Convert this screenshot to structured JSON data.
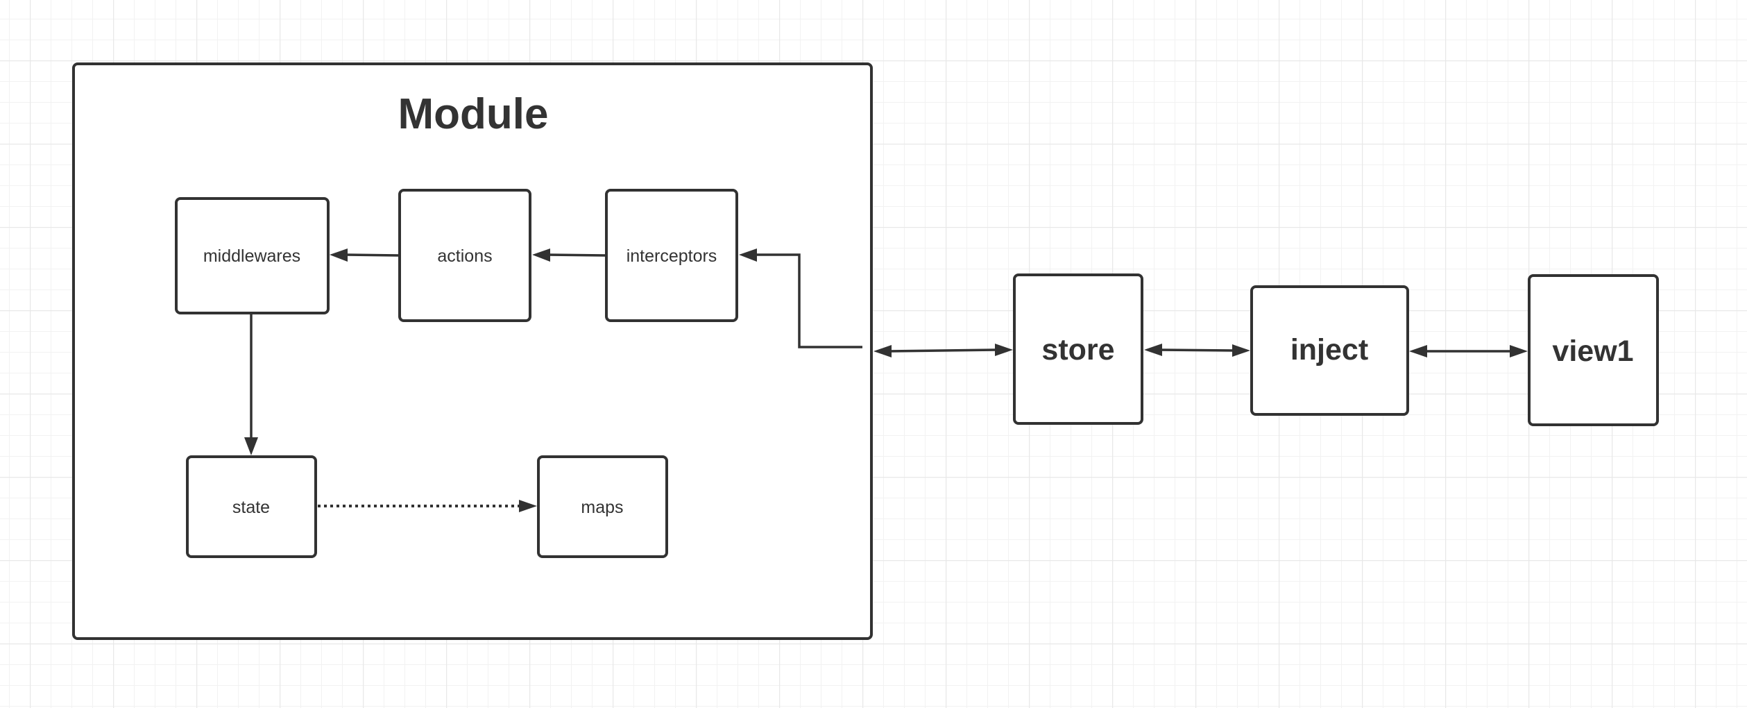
{
  "diagram": {
    "colors": {
      "stroke": "#323232",
      "text": "#333333",
      "background": "#ffffff",
      "grid_minor": "#f3f3f3",
      "grid_major": "#e9e9e9"
    },
    "container": {
      "title": "Module"
    },
    "nodes": {
      "middlewares": "middlewares",
      "actions": "actions",
      "interceptors": "interceptors",
      "state": "state",
      "maps": "maps",
      "store": "store",
      "inject": "inject",
      "view1": "view1"
    },
    "edges": [
      {
        "from": "actions",
        "to": "middlewares",
        "style": "solid",
        "direction": "forward"
      },
      {
        "from": "interceptors",
        "to": "actions",
        "style": "solid",
        "direction": "forward"
      },
      {
        "from": "module-boundary",
        "to": "interceptors",
        "style": "solid-elbow",
        "direction": "forward"
      },
      {
        "from": "middlewares",
        "to": "state",
        "style": "solid",
        "direction": "forward"
      },
      {
        "from": "state",
        "to": "maps",
        "style": "dotted",
        "direction": "forward"
      },
      {
        "from": "Module",
        "to": "store",
        "style": "solid",
        "direction": "both"
      },
      {
        "from": "store",
        "to": "inject",
        "style": "solid",
        "direction": "both"
      },
      {
        "from": "inject",
        "to": "view1",
        "style": "solid",
        "direction": "both"
      }
    ]
  }
}
